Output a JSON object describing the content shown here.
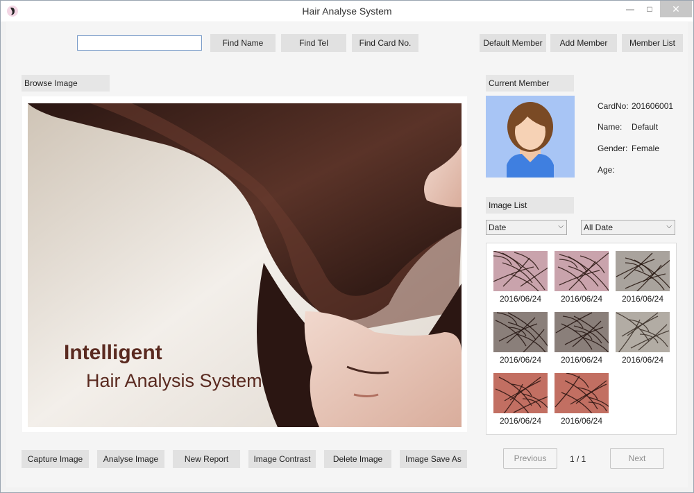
{
  "window": {
    "title": "Hair Analyse System",
    "minimize_glyph": "—",
    "maximize_glyph": "□",
    "close_glyph": "✕"
  },
  "toolbar": {
    "search_value": "",
    "find_name": "Find Name",
    "find_tel": "Find Tel",
    "find_card": "Find Card No.",
    "default_member": "Default Member",
    "add_member": "Add Member",
    "member_list": "Member List"
  },
  "browse": {
    "label": "Browse Image",
    "image_line1": "Intelligent",
    "image_line2": "Hair Analysis System"
  },
  "member": {
    "label": "Current Member",
    "card_label": "CardNo:",
    "card_value": "201606001",
    "name_label": "Name:",
    "name_value": "Default",
    "gender_label": "Gender:",
    "gender_value": "Female",
    "age_label": "Age:",
    "age_value": ""
  },
  "image_list": {
    "label": "Image List",
    "filter1": "Date",
    "filter2": "All Date",
    "items": [
      {
        "date": "2016/06/24",
        "tone": "pink"
      },
      {
        "date": "2016/06/24",
        "tone": "pink"
      },
      {
        "date": "2016/06/24",
        "tone": "gray-green"
      },
      {
        "date": "2016/06/24",
        "tone": "dark"
      },
      {
        "date": "2016/06/24",
        "tone": "dark"
      },
      {
        "date": "2016/06/24",
        "tone": "gray"
      },
      {
        "date": "2016/06/24",
        "tone": "red"
      },
      {
        "date": "2016/06/24",
        "tone": "red"
      }
    ]
  },
  "actions": {
    "capture": "Capture Image",
    "analyse": "Analyse Image",
    "new_report": "New Report",
    "contrast": "Image Contrast",
    "delete": "Delete Image",
    "save_as": "Image Save As"
  },
  "pagination": {
    "previous": "Previous",
    "page": "1 / 1",
    "next": "Next"
  },
  "colors": {
    "avatar_bg": "#a8c5f5",
    "hair": "#7a4a25",
    "shirt": "#3f7fe0"
  }
}
